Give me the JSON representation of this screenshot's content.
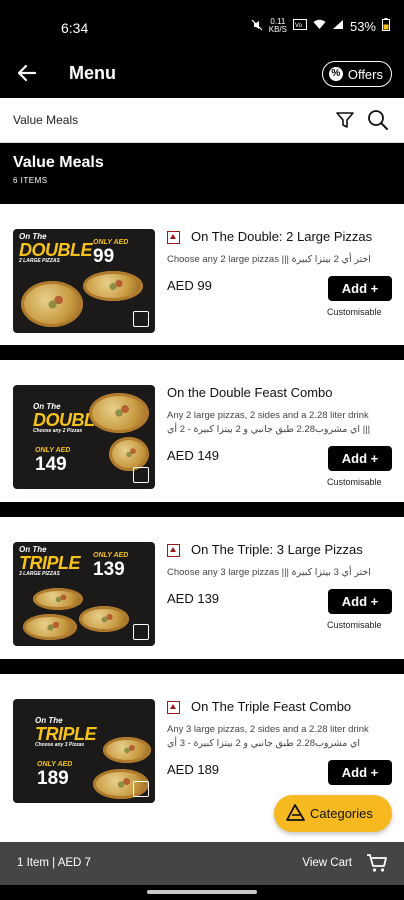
{
  "status_bar": {
    "time": "6:34",
    "data_speed_top": "0.11",
    "data_speed_bottom": "KB/S",
    "battery": "53%"
  },
  "app_bar": {
    "title": "Menu",
    "offers_label": "Offers",
    "offers_glyph": "%"
  },
  "crumb": {
    "text": "Value Meals"
  },
  "section": {
    "title": "Value Meals",
    "count": "6 ITEMS"
  },
  "items": [
    {
      "name": "On The Double: 2 Large Pizzas",
      "desc_en": "Choose any 2 large pizzas",
      "desc_sep": "|||",
      "desc_ar": "اختر أي 2 بيتزا كبيرة",
      "price": "AED 99",
      "add_label": "Add +",
      "note": "Customisable",
      "thumb": {
        "top": "On The",
        "main": "DOUBLE",
        "sub": "2 LARGE PIZZAS",
        "only": "ONLY AED",
        "price": "99"
      }
    },
    {
      "name": "On the Double Feast Combo",
      "desc_en": "Any 2 large pizzas, 2 sides and a 2.28 liter drink",
      "desc_sep": "|||",
      "desc_ar": "اي مشروب2.28 طبق جانبي و 2 بيتزا كبيرة - 2 أي",
      "price": "AED 149",
      "add_label": "Add +",
      "note": "Customisable",
      "thumb": {
        "top": "On The",
        "main": "DOUBLE",
        "sub": "Choose any 2 Pizzas",
        "only": "ONLY AED",
        "price": "149"
      }
    },
    {
      "name": "On The Triple: 3 Large Pizzas",
      "desc_en": "Choose any 3 large pizzas",
      "desc_sep": "|||",
      "desc_ar": "اختر أي 3 بيتزا كبيرة",
      "price": "AED 139",
      "add_label": "Add +",
      "note": "Customisable",
      "thumb": {
        "top": "On The",
        "main": "TRIPLE",
        "sub": "3 LARGE PIZZAS",
        "only": "ONLY AED",
        "price": "139"
      }
    },
    {
      "name": "On The Triple Feast Combo",
      "desc_en": "Any 3 large pizzas, 2 sides and a 2.28 liter drink",
      "desc_sep": "|||",
      "desc_ar": "اي مشروب2.28 طبق جانبي و 2 بيتزا كبيرة - 3 أي",
      "price": "AED 189",
      "add_label": "Add +",
      "note": "",
      "thumb": {
        "top": "On The",
        "main": "TRIPLE",
        "sub": "Choose any 3 Pizzas",
        "only": "ONLY AED",
        "price": "189"
      }
    }
  ],
  "categories_button": {
    "label": "Categories"
  },
  "cart": {
    "summary": "1 Item | AED 7",
    "view_label": "View Cart"
  },
  "colors": {
    "accent": "#f7b920",
    "brand_yellow": "#f7c31a",
    "bar": "#454545",
    "veg_mark": "#9b1b1b"
  }
}
